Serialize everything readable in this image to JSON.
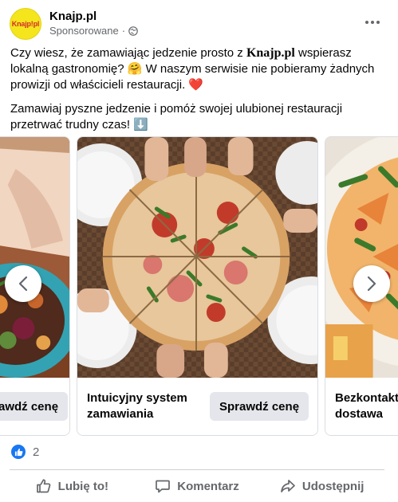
{
  "post": {
    "page_name": "Knajp.pl",
    "avatar_text": "Knajp!pl",
    "sponsored": "Sponsorowane",
    "meta_sep": "·",
    "more_icon": "more-horizontal-icon"
  },
  "message": {
    "p1_before": "Czy wiesz, że zamawiając jedzenie prosto z ",
    "brand": "Knajp.pl",
    "p1_after": "  wspierasz lokalną gastronomię? 🤗 W naszym serwisie nie pobieramy żadnych prowizji od właścicieli restauracji. ❤️",
    "p2": "Zamawiaj pyszne jedzenie i pomóż swojej ulubionej restauracji przetrwać trudny czas! ⬇️"
  },
  "carousel": {
    "cards": [
      {
        "title": "",
        "cta": "Sprawdź cenę",
        "image": "salad-bowl-photo"
      },
      {
        "title": "Intuicyjny system zamawiania",
        "cta": "Sprawdź cenę",
        "image": "pizza-sharing-photo"
      },
      {
        "title": "Bezkontaktowa dostawa",
        "cta": "",
        "image": "pasta-dish-photo"
      }
    ],
    "prev_icon": "chevron-left-icon",
    "next_icon": "chevron-right-icon"
  },
  "reactions": {
    "count": "2",
    "icon": "like-icon"
  },
  "actions": {
    "like": "Lubię to!",
    "comment": "Komentarz",
    "share": "Udostępnij"
  },
  "colors": {
    "link_blue": "#1877f2",
    "secondary_text": "#65676b",
    "button_gray": "#e4e6eb",
    "avatar_yellow": "#f5e51c",
    "avatar_red": "#d22b2b"
  }
}
